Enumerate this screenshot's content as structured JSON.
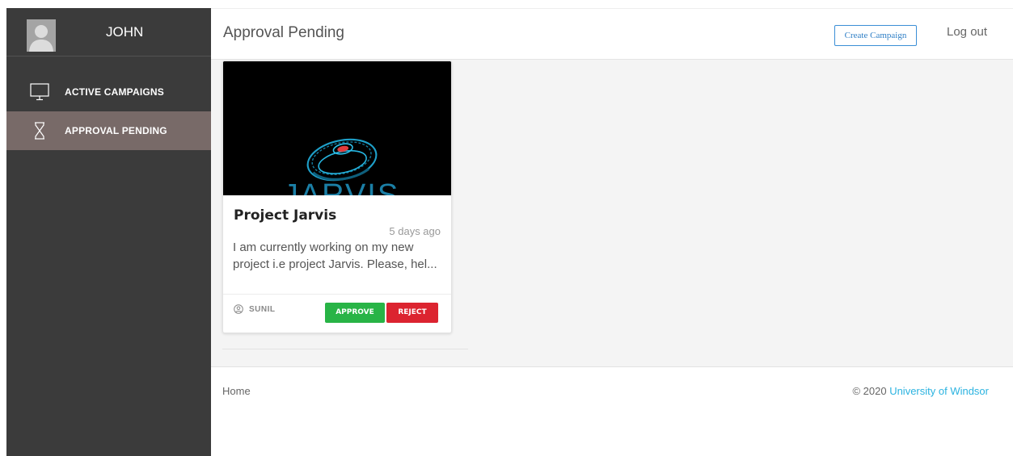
{
  "sidebar": {
    "username": "JOHN",
    "items": [
      {
        "label": "ACTIVE CAMPAIGNS",
        "icon": "monitor-icon",
        "active": false
      },
      {
        "label": "APPROVAL PENDING",
        "icon": "hourglass-icon",
        "active": true
      }
    ]
  },
  "header": {
    "title": "Approval Pending",
    "create_label": "Create Campaign",
    "logout_label": "Log out"
  },
  "campaigns": [
    {
      "title": "Project Jarvis",
      "time": "5 days ago",
      "description": "I am currently working on my new project i.e project Jarvis. Please, hel...",
      "author": "SUNIL",
      "approve_label": "APPROVE",
      "reject_label": "REJECT",
      "image_text": "JARVIS"
    }
  ],
  "footer": {
    "home_label": "Home",
    "copyright_prefix": "© 2020",
    "org_name": "University of Windsor"
  },
  "colors": {
    "sidebar_bg": "#3b3b3b",
    "sidebar_active": "#786a68",
    "approve": "#28b446",
    "reject": "#dc2430",
    "link": "#2bb3e0",
    "primary_outline": "#3b8fd6"
  }
}
